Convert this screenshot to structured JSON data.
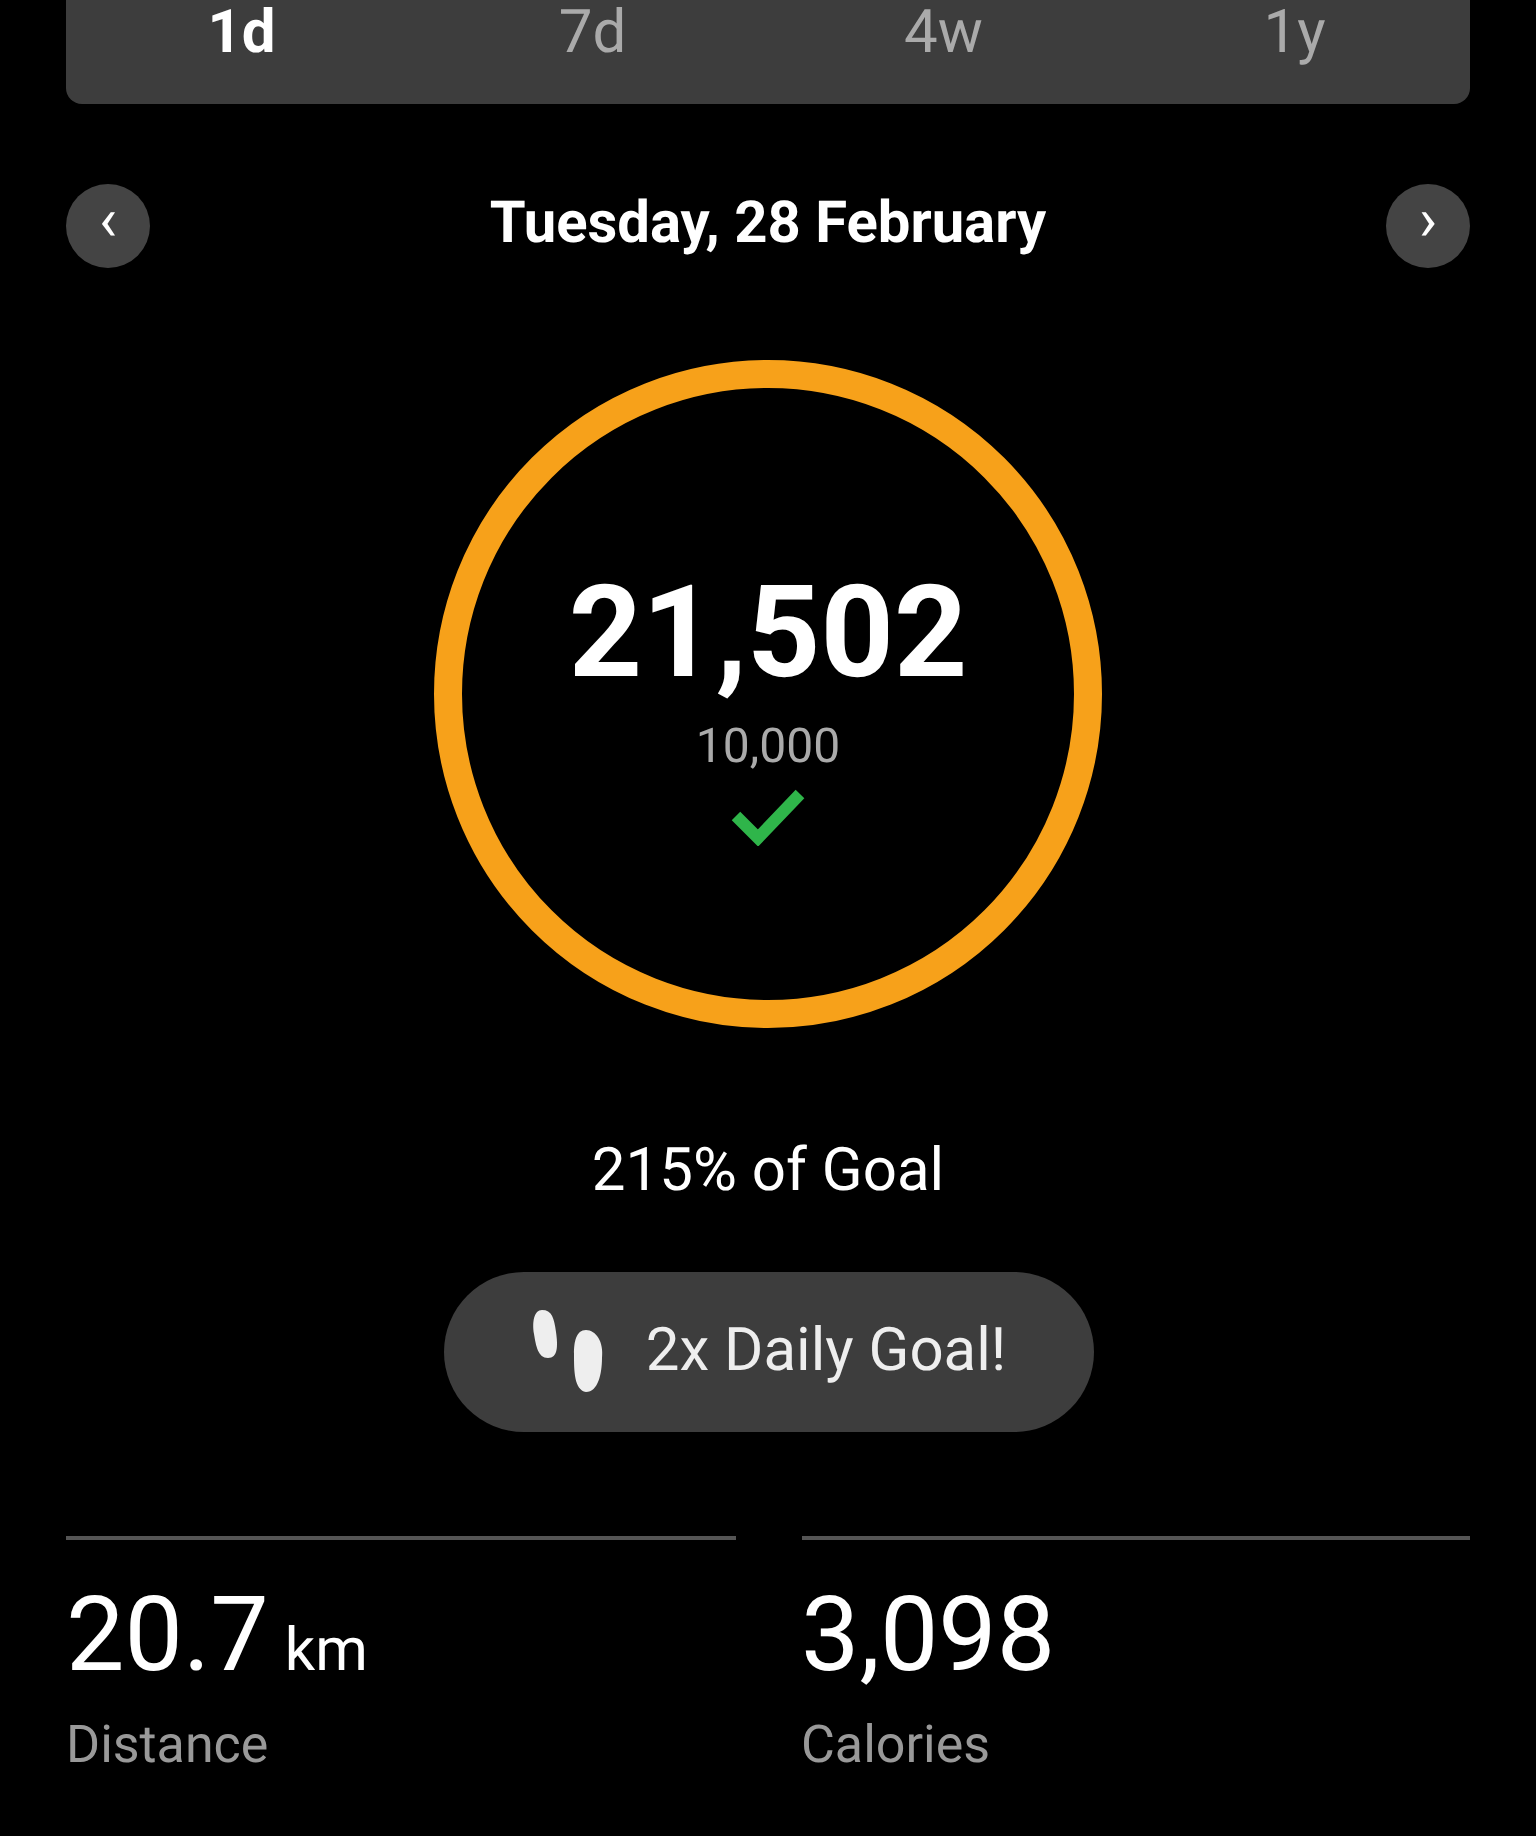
{
  "tabs": [
    {
      "label": "1d",
      "selected": true
    },
    {
      "label": "7d",
      "selected": false
    },
    {
      "label": "4w",
      "selected": false
    },
    {
      "label": "1y",
      "selected": false
    }
  ],
  "date_nav": {
    "previous": "‹",
    "title": "Tuesday, 28 February",
    "next": "›"
  },
  "ring": {
    "level": 1,
    "steps": "21,502",
    "goal": "10,000",
    "goal_met": true
  },
  "goal_percent": "215% of Goal",
  "badge": {
    "label": "2x Daily Goal!"
  },
  "stats": [
    {
      "value": "20.7",
      "unit": "km",
      "label": "Distance"
    },
    {
      "value": "3,098",
      "label": "Calories"
    }
  ]
}
